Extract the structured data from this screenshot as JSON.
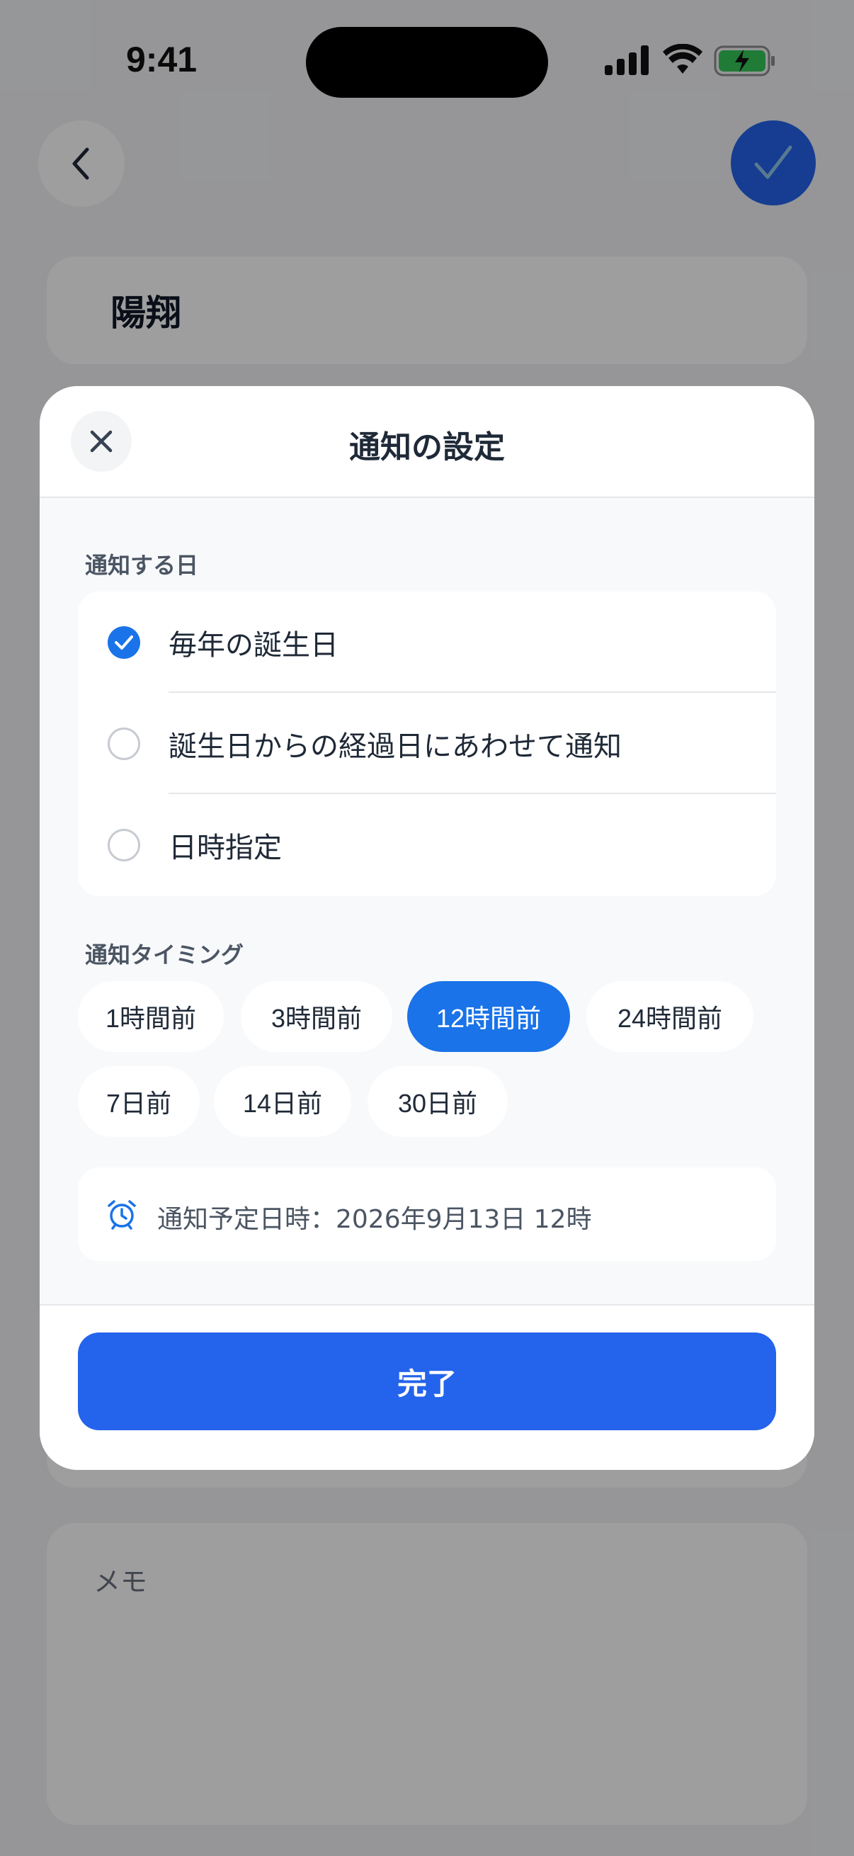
{
  "status_bar": {
    "time": "9:41",
    "icons": [
      "signal-icon",
      "wifi-icon",
      "battery-charging-icon"
    ]
  },
  "background": {
    "back_icon": "chevron-left-icon",
    "confirm_icon": "checkmark-icon",
    "name": "陽翔",
    "memo_label": "メモ"
  },
  "modal": {
    "title": "通知の設定",
    "close_icon": "close-icon",
    "notify_day_label": "通知する日",
    "notify_day_options": [
      {
        "label": "毎年の誕生日",
        "checked": true
      },
      {
        "label": "誕生日からの経過日にあわせて通知",
        "checked": false
      },
      {
        "label": "日時指定",
        "checked": false
      }
    ],
    "timing_label": "通知タイミング",
    "timing_chips": [
      {
        "label": "1時間前",
        "selected": false
      },
      {
        "label": "3時間前",
        "selected": false
      },
      {
        "label": "12時間前",
        "selected": true
      },
      {
        "label": "24時間前",
        "selected": false
      },
      {
        "label": "7日前",
        "selected": false
      },
      {
        "label": "14日前",
        "selected": false
      },
      {
        "label": "30日前",
        "selected": false
      }
    ],
    "schedule_icon": "alarm-clock-icon",
    "schedule_text": "通知予定日時：2026年9月13日 12時",
    "done_label": "完了"
  },
  "colors": {
    "accent": "#1a73e8",
    "primary_button": "#2463eb",
    "overlay": "rgba(0,0,0,0.38)"
  }
}
